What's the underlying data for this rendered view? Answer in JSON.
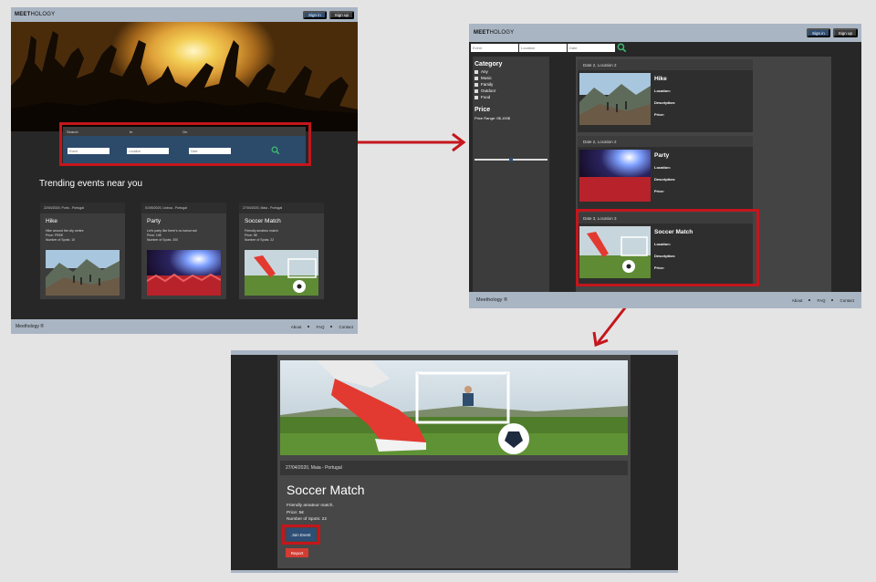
{
  "colors": {
    "highlight_box": "#c4161c",
    "nav_bar": "#a9b5c3",
    "signin": "#2d4e75",
    "join_event": "#2d4e75",
    "report": "#d33c33",
    "search_icon": "#3cb371"
  },
  "brand": {
    "bold": "MEET",
    "rest": "HOLOGY"
  },
  "auth": {
    "signin": "Sign in",
    "signup": "Sign up"
  },
  "footer": {
    "copyright": "Meethology ®",
    "links": [
      "About",
      "FAQ",
      "Contact"
    ]
  },
  "home": {
    "search": {
      "label_search": "Search",
      "label_in": "In",
      "label_on": "On",
      "event_placeholder": "Event",
      "location_placeholder": "Location",
      "date_placeholder": "Date"
    },
    "trending_title": "Trending events near you",
    "cards": [
      {
        "date": "22/04/2020, Porto - Portugal",
        "title": "Hike",
        "desc": "Hike around the city centre",
        "price": "Price: FREE",
        "spots": "Number of Spots: 10"
      },
      {
        "date": "01/05/2020, Lisboa - Portugal",
        "title": "Party",
        "desc": "Let's party like there's no tomorrow!",
        "price": "Price: 10€",
        "spots": "Number of Spots: 200"
      },
      {
        "date": "27/04/2020, Maia - Portugal",
        "title": "Soccer Match",
        "desc": "Friendly amateur match",
        "price": "Price: 5€",
        "spots": "Number of Spots: 22"
      }
    ]
  },
  "results": {
    "search": {
      "event_placeholder": "Event",
      "location_placeholder": "Location",
      "date_placeholder": "Date"
    },
    "filters": {
      "category_title": "Category",
      "options": [
        "Any",
        "Music",
        "Family",
        "Outdoor",
        "Food"
      ],
      "price_title": "Price",
      "price_range": "Price Range: 0$-100$",
      "price_slider_position": 0.5
    },
    "field_labels": {
      "location": "Location:",
      "description": "Description:",
      "price": "Price:"
    },
    "cards": [
      {
        "header": "Date 2, Location 2",
        "title": "Hike"
      },
      {
        "header": "Date 2, Location 2",
        "title": "Party"
      },
      {
        "header": "Date 3, Location 3",
        "title": "Soccer Match"
      }
    ]
  },
  "detail": {
    "date_location": "27/04/2020, Maia - Portugal",
    "title": "Soccer Match",
    "description": "Friendly amateur match.",
    "price": "Price: 5€",
    "spots": "Number of Spots: 22",
    "join_button": "Join Event",
    "report_button": "Report"
  }
}
